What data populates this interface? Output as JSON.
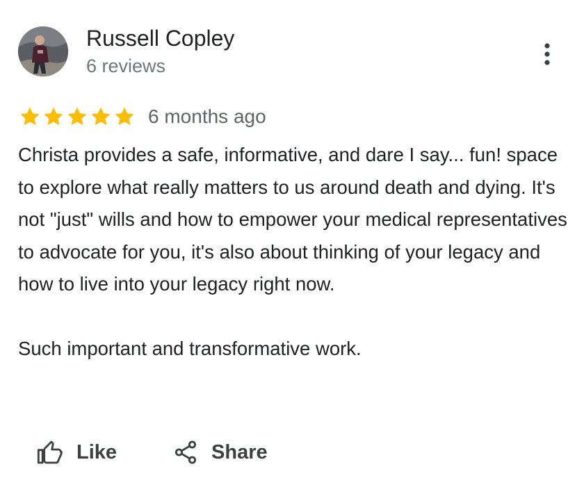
{
  "review": {
    "author": {
      "name": "Russell Copley",
      "reviews_count": "6 reviews"
    },
    "rating": 5,
    "rating_max": 5,
    "time": "6 months ago",
    "text": "Christa provides a safe, informative, and dare I say... fun! space to explore what really matters to us around death and dying. It's not \"just\" wills and how to empower your medical representatives to advocate for you, it's also about thinking of your legacy and how to live into your legacy right now.\n\nSuch important and transformative work.",
    "actions": {
      "like_label": "Like",
      "share_label": "Share"
    },
    "icons": {
      "more": "more-vert-icon",
      "star": "star-icon",
      "like": "thumb-up-icon",
      "share": "share-icon"
    }
  },
  "colors": {
    "star": "#fbbc04",
    "primary_text": "#202124",
    "secondary_text": "#70757a",
    "action_text": "#3c4043"
  }
}
